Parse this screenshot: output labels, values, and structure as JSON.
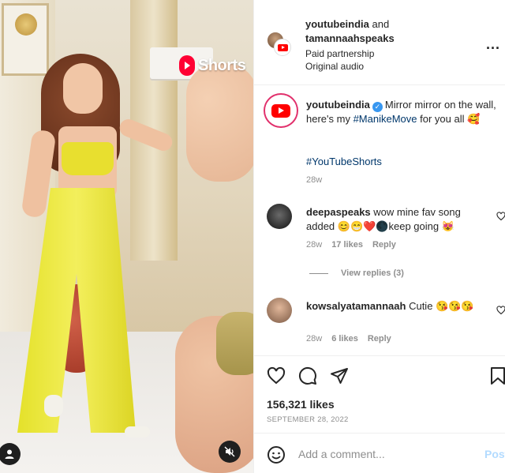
{
  "media": {
    "badge_text": "Shorts",
    "user_tag_icon": "user-icon",
    "mute_icon": "speaker-muted-icon"
  },
  "header": {
    "author_1": "youtubeindia",
    "joiner": "and",
    "author_2": "tamannaahspeaks",
    "subtitle_1": "Paid partnership",
    "subtitle_2": "Original audio",
    "more_label": "..."
  },
  "caption": {
    "username": "youtubeindia",
    "text_1": "Mirror mirror on the wall, here's my ",
    "hashtag_1": "#ManikeMove",
    "text_2": " for you all ",
    "emoji": "🥰",
    "hashtag_2": "#YouTubeShorts",
    "time": "28w"
  },
  "comments": [
    {
      "username": "deepaspeaks",
      "text": "wow mine fav song added 😊😁❤️🌑keep going 😻",
      "time": "28w",
      "likes": "17 likes",
      "reply": "Reply",
      "view_replies": "View replies (3)"
    },
    {
      "username": "kowsalyatamannaah",
      "text": "Cutie 😘😘😘",
      "time": "28w",
      "likes": "6 likes",
      "reply": "Reply"
    }
  ],
  "actions": {
    "likes": "156,321 likes",
    "date": "SEPTEMBER 28, 2022"
  },
  "composer": {
    "placeholder": "Add a comment...",
    "post_label": "Post"
  },
  "colors": {
    "link": "#00376b",
    "verified": "#3897f0",
    "post_disabled": "#b3dbff",
    "youtube_red": "#ff0000"
  }
}
